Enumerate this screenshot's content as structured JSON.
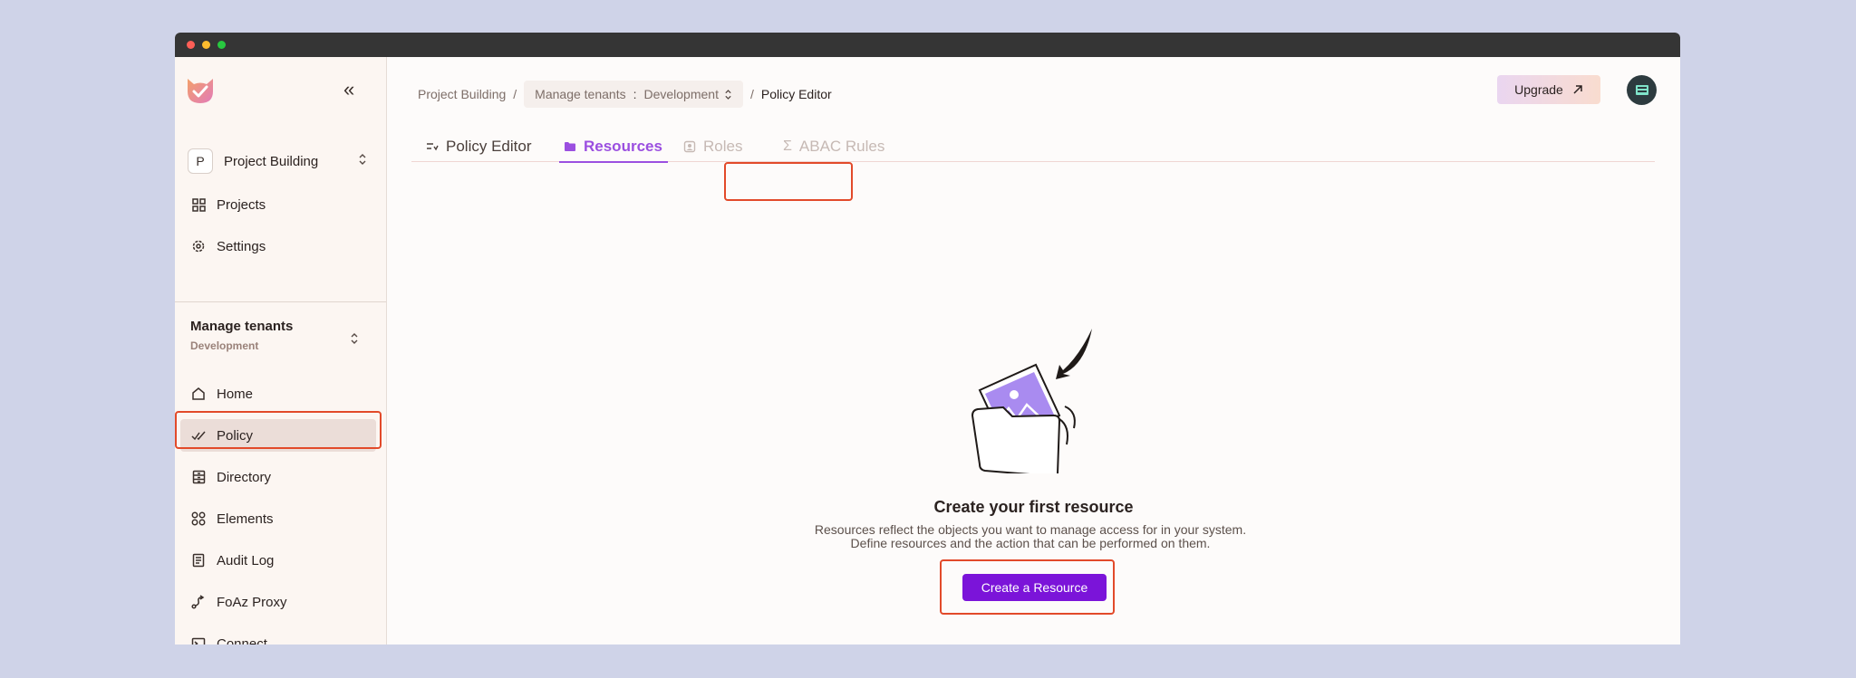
{
  "sidebar": {
    "project": {
      "badge": "P",
      "name": "Project Building"
    },
    "top_items": [
      {
        "label": "Projects",
        "icon": "grid-icon"
      },
      {
        "label": "Settings",
        "icon": "gear-icon"
      }
    ],
    "tenant": {
      "title": "Manage tenants",
      "env": "Development"
    },
    "items": [
      {
        "label": "Home",
        "icon": "home-icon"
      },
      {
        "label": "Policy",
        "icon": "check-icon"
      },
      {
        "label": "Directory",
        "icon": "directory-icon"
      },
      {
        "label": "Elements",
        "icon": "elements-icon"
      },
      {
        "label": "Audit Log",
        "icon": "document-icon"
      },
      {
        "label": "FoAz Proxy",
        "icon": "route-icon"
      },
      {
        "label": "Connect",
        "icon": "terminal-icon"
      }
    ]
  },
  "header": {
    "breadcrumb": {
      "project": "Project Building",
      "separator": "/",
      "select_left": "Manage tenants",
      "select_sep": ":",
      "select_right": "Development",
      "current": "Policy Editor"
    },
    "upgrade_label": "Upgrade"
  },
  "tabs": [
    {
      "label": "Policy Editor",
      "active": false
    },
    {
      "label": "Resources",
      "active": true
    },
    {
      "label": "Roles",
      "active": false
    },
    {
      "label": "ABAC Rules",
      "active": false
    }
  ],
  "empty_state": {
    "title": "Create your first resource",
    "description": "Resources reflect the objects you want to manage access for in your system. Define resources and the action that can be performed on them.",
    "cta_label": "Create a Resource"
  },
  "colors": {
    "accent": "#7b14d9",
    "tab_active": "#9b4fe0",
    "highlight": "#e24a2a"
  }
}
